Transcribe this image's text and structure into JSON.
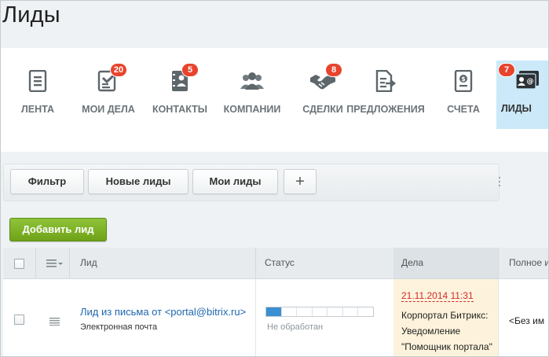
{
  "page": {
    "title": "Лиды"
  },
  "crm_menu": [
    {
      "id": "feed",
      "label": "ЛЕНТА",
      "icon": "feed-icon",
      "badge": null
    },
    {
      "id": "mytasks",
      "label": "МОИ ДЕЛА",
      "icon": "tasks-checklist-icon",
      "badge": "20"
    },
    {
      "id": "contacts",
      "label": "КОНТАКТЫ",
      "icon": "contact-book-icon",
      "badge": "5"
    },
    {
      "id": "companies",
      "label": "КОМПАНИИ",
      "icon": "people-group-icon",
      "badge": null
    },
    {
      "id": "deals",
      "label": "СДЕЛКИ",
      "icon": "handshake-icon",
      "badge": "8"
    },
    {
      "id": "quotes",
      "label": "ПРЕДЛОЖЕНИЯ",
      "icon": "document-export-icon",
      "badge": null
    },
    {
      "id": "invoices",
      "label": "СЧЕТА",
      "icon": "invoice-dollar-icon",
      "badge": null
    },
    {
      "id": "leads",
      "label": "ЛИДЫ",
      "icon": "lead-card-icon",
      "badge": "7",
      "active": true
    }
  ],
  "filter": {
    "filter_label": "Фильтр",
    "new_leads_label": "Новые лиды",
    "my_leads_label": "Мои лиды",
    "add_filter_label": "+"
  },
  "actions": {
    "add_lead_label": "Добавить лид"
  },
  "grid": {
    "columns": {
      "lead": "Лид",
      "status": "Статус",
      "deals": "Дела",
      "fullname": "Полное и"
    },
    "rows": [
      {
        "title": "Лид из письма от <portal@bitrix.ru>",
        "source": "Электронная почта",
        "status": "Не обработан",
        "status_progress_steps_filled": 1,
        "status_progress_steps_total": 7,
        "deal_date": "21.11.2014 11:31",
        "deal_text": "Корпортал Битрикс: Уведомление \"Помощник портала\"",
        "fullname": "<Без им"
      }
    ]
  },
  "colors": {
    "accent_blue": "#2067b0",
    "badge_red": "#e8442d",
    "add_button_green": "#7cb22a",
    "active_tab": "#cbe9f8"
  }
}
